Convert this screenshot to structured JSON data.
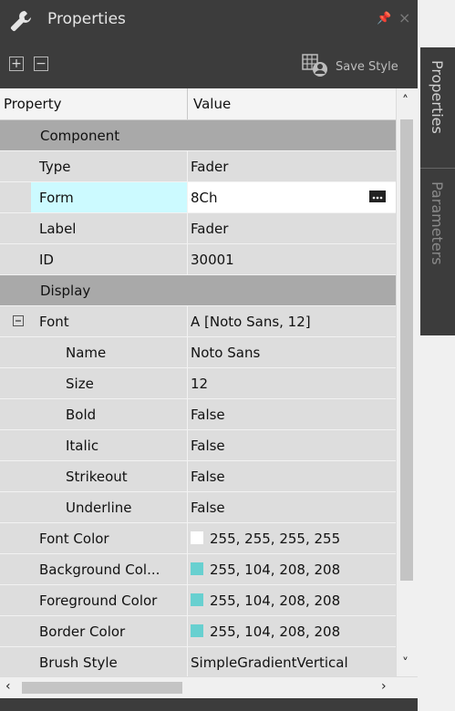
{
  "window": {
    "title": "Properties",
    "pin_glyph": "📌",
    "close_glyph": "×"
  },
  "toolbar": {
    "expand_label": "+",
    "collapse_label": "−",
    "save_style_label": "Save Style"
  },
  "grid": {
    "header": {
      "property": "Property",
      "value": "Value"
    },
    "rows": [
      {
        "kind": "category",
        "name": "Component"
      },
      {
        "kind": "prop",
        "name": "Type",
        "value": "Fader"
      },
      {
        "kind": "prop",
        "name": "Form",
        "value": "8Ch",
        "selected": true
      },
      {
        "kind": "prop",
        "name": "Label",
        "value": "Fader"
      },
      {
        "kind": "prop",
        "name": "ID",
        "value": "30001"
      },
      {
        "kind": "category",
        "name": "Display"
      },
      {
        "kind": "prop",
        "name": "Font",
        "value": "A [Noto Sans, 12]"
      },
      {
        "kind": "prop",
        "name": "Name",
        "value": "Noto Sans"
      },
      {
        "kind": "prop",
        "name": "Size",
        "value": "12"
      },
      {
        "kind": "prop",
        "name": "Bold",
        "value": "False"
      },
      {
        "kind": "prop",
        "name": "Italic",
        "value": "False"
      },
      {
        "kind": "prop",
        "name": "Strikeout",
        "value": "False"
      },
      {
        "kind": "prop",
        "name": "Underline",
        "value": "False"
      },
      {
        "kind": "prop",
        "name": "Font Color",
        "value": "255, 255, 255, 255",
        "swatch": "#ffffff"
      },
      {
        "kind": "prop",
        "name": "Background Col...",
        "value": "255, 104, 208, 208",
        "swatch": "#68d0d0"
      },
      {
        "kind": "prop",
        "name": "Foreground Color",
        "value": "255, 104, 208, 208",
        "swatch": "#68d0d0"
      },
      {
        "kind": "prop",
        "name": "Border Color",
        "value": "255, 104, 208, 208",
        "swatch": "#68d0d0"
      },
      {
        "kind": "prop",
        "name": "Brush Style",
        "value": "SimpleGradientVertical"
      }
    ]
  },
  "side_tabs": [
    {
      "label": "Properties",
      "active": true
    },
    {
      "label": "Parameters",
      "active": false
    }
  ],
  "colors": {
    "selected_row": "#ccfaff",
    "category": "#a9a9a9",
    "row": "#dddddd",
    "swatch_teal": "#68d0d0"
  }
}
